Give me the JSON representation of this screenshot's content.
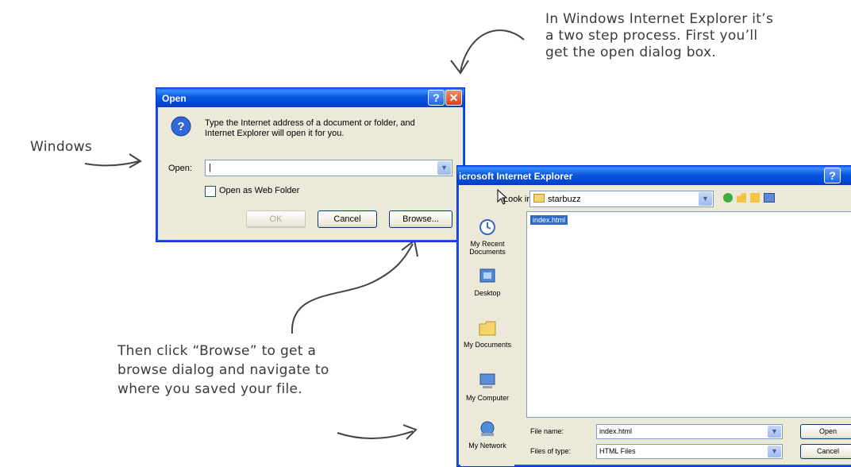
{
  "annotations": {
    "top_right": [
      "In Windows Internet Explorer it’s",
      "a two step process.  First you’ll",
      "get the open dialog box."
    ],
    "left": "Windows",
    "bottom": [
      "Then click “Browse” to get a",
      "browse dialog and navigate to",
      "where you saved your file."
    ]
  },
  "open_dialog": {
    "title": "Open",
    "help_button": "?",
    "close_button": "✕",
    "message_lines": [
      "Type the Internet address of a document or folder, and",
      "Internet Explorer will open it for you."
    ],
    "open_label": "Open:",
    "open_value": "|",
    "checkbox_label": "Open as Web Folder",
    "ok_label": "OK",
    "cancel_label": "Cancel",
    "browse_label": "Browse..."
  },
  "browse_dialog": {
    "title": "icrosoft Internet Explorer",
    "look_in_label": "Look in:",
    "look_in_value": "starbuzz",
    "file_item": "index.html",
    "places": [
      "My Recent Documents",
      "Desktop",
      "My Documents",
      "My Computer",
      "My Network"
    ],
    "file_name_label": "File name:",
    "file_name_value": "index.html",
    "file_type_label": "Files of type:",
    "file_type_value": "HTML Files",
    "open_label": "Open",
    "cancel_label": "Cancel"
  },
  "icons": [
    "question-icon",
    "folder-icon",
    "back-icon",
    "up-folder-icon",
    "new-folder-icon",
    "view-menu-icon",
    "recent-documents-icon",
    "desktop-icon",
    "my-documents-icon",
    "my-computer-icon",
    "my-network-icon",
    "mouse-cursor-icon"
  ],
  "colors": {
    "title_bar": "#0054e3",
    "dialog_bg": "#ece9d8",
    "selection": "#316ac5",
    "close_red": "#d9421b"
  }
}
